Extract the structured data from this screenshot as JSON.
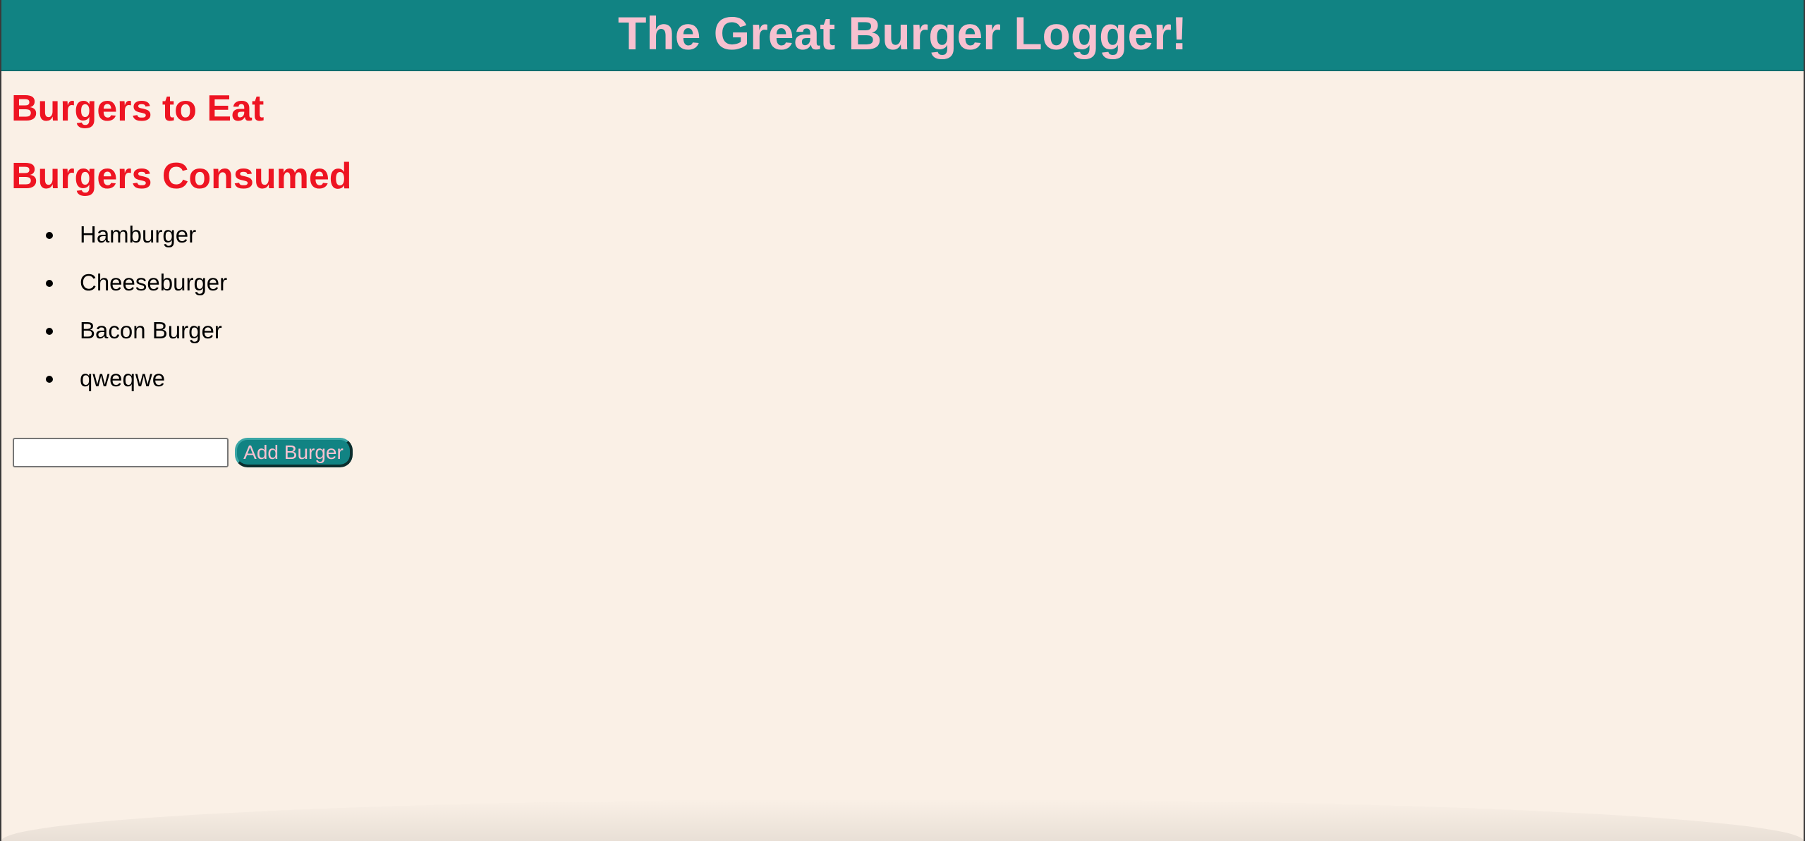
{
  "header": {
    "title": "The Great Burger Logger!"
  },
  "sections": {
    "to_eat_title": "Burgers to Eat",
    "consumed_title": "Burgers Consumed"
  },
  "consumed": [
    "Hamburger",
    "Cheeseburger",
    "Bacon Burger",
    "qweqwe"
  ],
  "form": {
    "input_value": "",
    "input_placeholder": "",
    "button_label": "Add Burger"
  },
  "colors": {
    "header_bg": "#118383",
    "header_text": "#F7C1D0",
    "section_title": "#EE1422",
    "page_bg": "#FAF0E6"
  }
}
